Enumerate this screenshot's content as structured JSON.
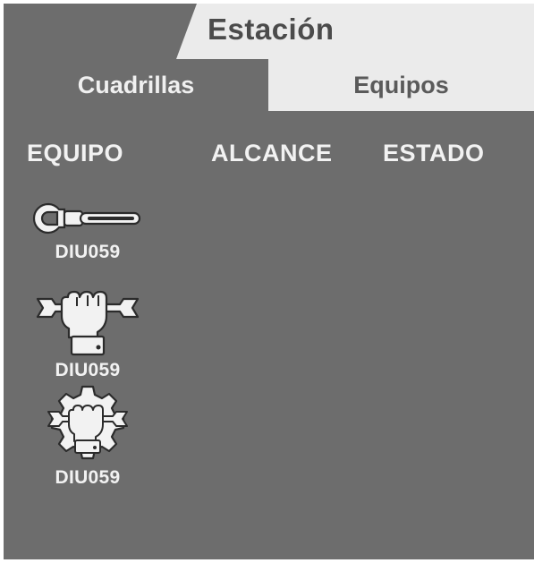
{
  "header": {
    "title": "Estación"
  },
  "tabs": [
    {
      "label": "Cuadrillas",
      "active": true
    },
    {
      "label": "Equipos",
      "active": false
    }
  ],
  "table": {
    "columns": [
      "EQUIPO",
      "ALCANCE",
      "ESTADO"
    ]
  },
  "items": [
    {
      "id": "DIU059",
      "icon": "wrench-icon"
    },
    {
      "id": "DIU059",
      "icon": "hand-wrench-icon"
    },
    {
      "id": "DIU059",
      "icon": "gear-hand-wrench-icon"
    }
  ],
  "colors": {
    "panel": "#6d6d6d",
    "header_bg": "#ebebeb",
    "header_text": "#4b4b4b",
    "light_text": "#f2f2f2"
  }
}
